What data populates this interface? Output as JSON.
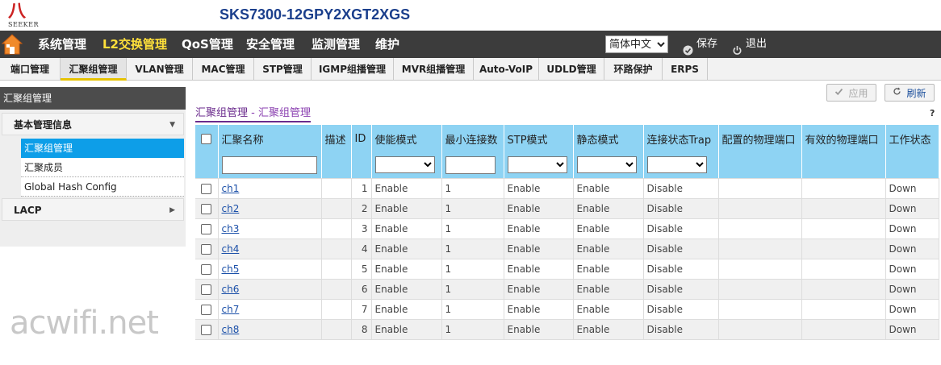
{
  "header": {
    "logo_text": "SEEKER",
    "model": "SKS7300-12GPY2XGT2XGS"
  },
  "main_nav": [
    {
      "label": "系统管理",
      "active": false
    },
    {
      "label": "L2交换管理",
      "active": true
    },
    {
      "label": "QoS管理",
      "active": false
    },
    {
      "label": "安全管理",
      "active": false
    },
    {
      "label": "监测管理",
      "active": false
    },
    {
      "label": "维护",
      "active": false
    }
  ],
  "language": {
    "selected": "简体中文"
  },
  "actions": {
    "save": "保存",
    "logout": "退出"
  },
  "sub_nav": [
    {
      "label": "端口管理",
      "active": false
    },
    {
      "label": "汇聚组管理",
      "active": true
    },
    {
      "label": "VLAN管理",
      "active": false
    },
    {
      "label": "MAC管理",
      "active": false
    },
    {
      "label": "STP管理",
      "active": false
    },
    {
      "label": "IGMP组播管理",
      "active": false
    },
    {
      "label": "MVR组播管理",
      "active": false
    },
    {
      "label": "Auto-VoIP",
      "active": false
    },
    {
      "label": "UDLD管理",
      "active": false
    },
    {
      "label": "环路保护",
      "active": false
    },
    {
      "label": "ERPS",
      "active": false
    }
  ],
  "sidebar": {
    "title": "汇聚组管理",
    "group1": "基本管理信息",
    "items": [
      "汇聚组管理",
      "汇聚成员",
      "Global Hash Config"
    ],
    "group2": "LACP"
  },
  "buttons": {
    "apply": "应用",
    "refresh": "刷新",
    "help": "?"
  },
  "content_title": {
    "main": "汇聚组管理",
    "sep": " - ",
    "sub": "汇聚组管理"
  },
  "table": {
    "headers": [
      "汇聚名称",
      "描述",
      "ID",
      "使能模式",
      "最小连接数",
      "STP模式",
      "静态模式",
      "连接状态Trap",
      "配置的物理端口",
      "有效的物理端口",
      "工作状态"
    ],
    "rows": [
      {
        "name": "ch1",
        "id": "1",
        "admin": "Enable",
        "min": "1",
        "stp": "Enable",
        "static": "Enable",
        "trap": "Disable",
        "state": "Down"
      },
      {
        "name": "ch2",
        "id": "2",
        "admin": "Enable",
        "min": "1",
        "stp": "Enable",
        "static": "Enable",
        "trap": "Disable",
        "state": "Down"
      },
      {
        "name": "ch3",
        "id": "3",
        "admin": "Enable",
        "min": "1",
        "stp": "Enable",
        "static": "Enable",
        "trap": "Disable",
        "state": "Down"
      },
      {
        "name": "ch4",
        "id": "4",
        "admin": "Enable",
        "min": "1",
        "stp": "Enable",
        "static": "Enable",
        "trap": "Disable",
        "state": "Down"
      },
      {
        "name": "ch5",
        "id": "5",
        "admin": "Enable",
        "min": "1",
        "stp": "Enable",
        "static": "Enable",
        "trap": "Disable",
        "state": "Down"
      },
      {
        "name": "ch6",
        "id": "6",
        "admin": "Enable",
        "min": "1",
        "stp": "Enable",
        "static": "Enable",
        "trap": "Disable",
        "state": "Down"
      },
      {
        "name": "ch7",
        "id": "7",
        "admin": "Enable",
        "min": "1",
        "stp": "Enable",
        "static": "Enable",
        "trap": "Disable",
        "state": "Down"
      },
      {
        "name": "ch8",
        "id": "8",
        "admin": "Enable",
        "min": "1",
        "stp": "Enable",
        "static": "Enable",
        "trap": "Disable",
        "state": "Down"
      }
    ]
  },
  "watermark": "acwifi.net",
  "colors": {
    "accent_yellow": "#ffe03a",
    "header_blue": "#8ed3f3",
    "active_item": "#0d9ee8",
    "title_purple": "#6a2a8c"
  }
}
